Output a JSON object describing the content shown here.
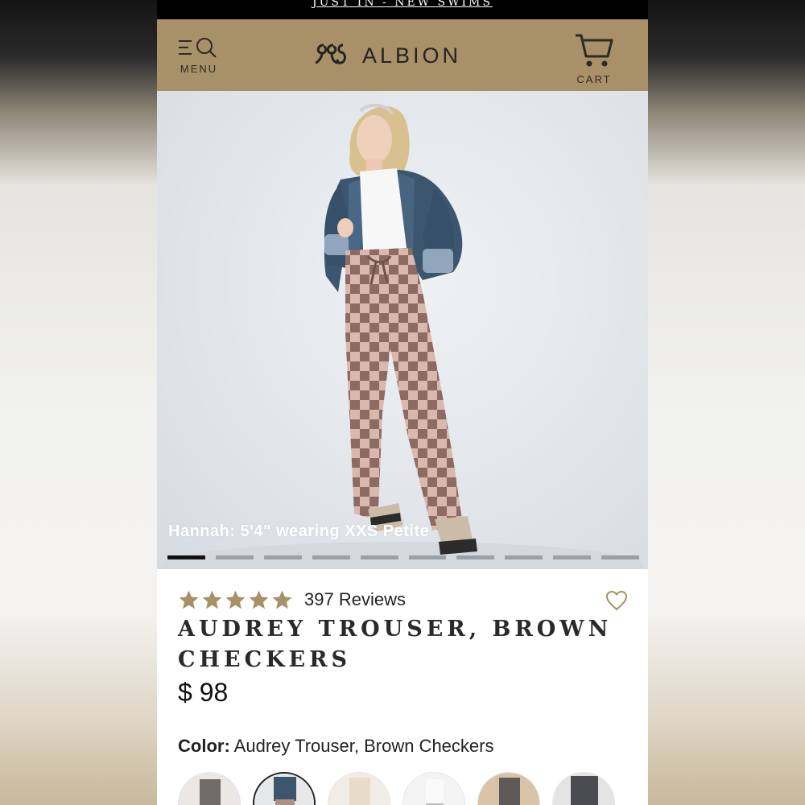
{
  "announcement": {
    "text": "JUST IN - NEW SWIMS"
  },
  "header": {
    "menu_label": "MENU",
    "brand": "ALBION",
    "cart_label": "CART",
    "background": "#a89068"
  },
  "hero": {
    "caption": "Hannah: 5'4\" wearing XXS Petite",
    "slide_count": 10,
    "active_slide": 1
  },
  "product": {
    "rating": 5,
    "reviews_text": "397 Reviews",
    "title": "AUDREY TROUSER, BROWN CHECKERS",
    "price": "$ 98",
    "color_label": "Color:",
    "color_value": "Audrey Trouser, Brown Checkers",
    "star_color": "#a89068",
    "swatch_count_visible": 6,
    "selected_swatch": 2
  },
  "icons": {
    "menu": "menu-search-icon",
    "cart": "cart-icon",
    "logo": "albion-logo-icon",
    "star": "star-icon",
    "wishlist": "heart-icon"
  }
}
